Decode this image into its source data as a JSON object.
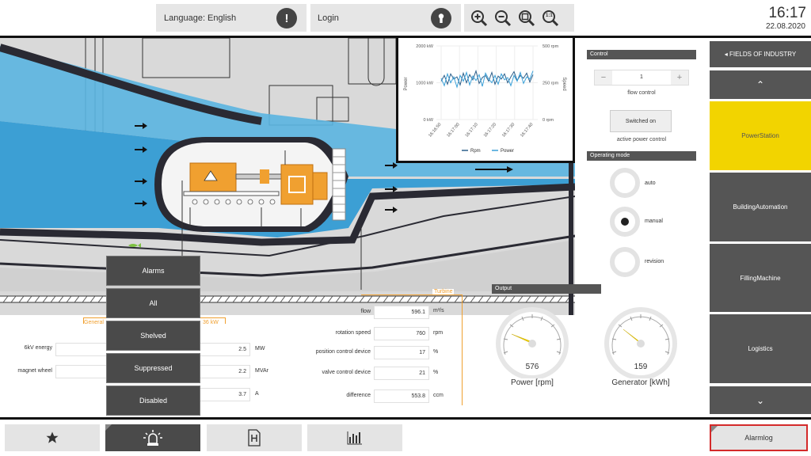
{
  "header": {
    "language_label": "Language: English",
    "login_label": "Login",
    "zoom_reset_label": "1:1",
    "time": "16:17",
    "date": "22.08.2020"
  },
  "chart_data": {
    "type": "line",
    "x": [
      "16:16:50",
      "16:17:00",
      "16:17:10",
      "16:17:20",
      "16:17:30",
      "16:17:40"
    ],
    "left_ticks": [
      "2000 kW",
      "1000 kW",
      "0 kW"
    ],
    "right_ticks": [
      "500 rpm",
      "250 rpm",
      "0 rpm"
    ],
    "ylabel": "Power",
    "ylabel_right": "Speed",
    "series": [
      {
        "name": "Rpm",
        "color": "#2c5f8a",
        "values": [
          52,
          60,
          48,
          62,
          55,
          58,
          47,
          63,
          50,
          61,
          54,
          66,
          49,
          57,
          60,
          52,
          64,
          48,
          59,
          55,
          62,
          50,
          58,
          65,
          53,
          60,
          56,
          63,
          51,
          61
        ]
      },
      {
        "name": "Power",
        "color": "#3aa0d8",
        "values": [
          56,
          46,
          62,
          50,
          58,
          44,
          60,
          52,
          64,
          47,
          59,
          53,
          61,
          45,
          63,
          55,
          50,
          60,
          48,
          62,
          54,
          57,
          46,
          60,
          52,
          64,
          49,
          58,
          55,
          66
        ]
      }
    ],
    "ylim": [
      0,
      100
    ]
  },
  "control": {
    "section_title": "Control",
    "flow_value": "1",
    "minus": "−",
    "plus": "+",
    "flow_label": "flow control",
    "switch_label": "Switched on",
    "active_power_label": "active power control"
  },
  "operating_mode": {
    "section_title": "Operating mode",
    "modes": [
      "auto",
      "manual",
      "revision"
    ],
    "selected": "manual"
  },
  "output": {
    "section_title": "Output",
    "gauges": [
      {
        "label": "Power [rpm]",
        "value": "576"
      },
      {
        "label": "Generator [kWh]",
        "value": "159"
      }
    ]
  },
  "nav": {
    "header": "◂ FIELDS OF INDUSTRY",
    "up": "⌃",
    "items": [
      "PowerStation",
      "BuildingAutomation",
      "FillingMachine",
      "Logistics"
    ],
    "active": "PowerStation",
    "down": "⌄"
  },
  "generator": {
    "title": "General",
    "power_label": "36 kW",
    "rows": [
      {
        "label": "6kV energy",
        "value": "2.5",
        "unit": "MW"
      },
      {
        "label": "magnet wheel",
        "value": "2.2",
        "unit": "MVAr"
      },
      {
        "label": "",
        "value": "3.7",
        "unit": "A"
      }
    ]
  },
  "turbine": {
    "title": "Turbine",
    "rows": [
      {
        "label": "flow",
        "value": "596.1",
        "unit": "m³/s"
      },
      {
        "label": "rotation speed",
        "value": "760",
        "unit": "rpm"
      },
      {
        "label": "position control device",
        "value": "17",
        "unit": "%"
      },
      {
        "label": "valve control device",
        "value": "21",
        "unit": "%"
      },
      {
        "label": "difference",
        "value": "553.8",
        "unit": "ccm"
      }
    ]
  },
  "alarms": {
    "items": [
      "Alarms",
      "All",
      "Shelved",
      "Suppressed",
      "Disabled"
    ]
  },
  "footer": {
    "alarmlog_label": "Alarmlog"
  },
  "colors": {
    "accent_yellow": "#f2d400",
    "nav_gray": "#555555",
    "water_blue": "#5ab4e0",
    "machine_orange": "#f0a030",
    "alarm_red": "#d42a2a"
  }
}
